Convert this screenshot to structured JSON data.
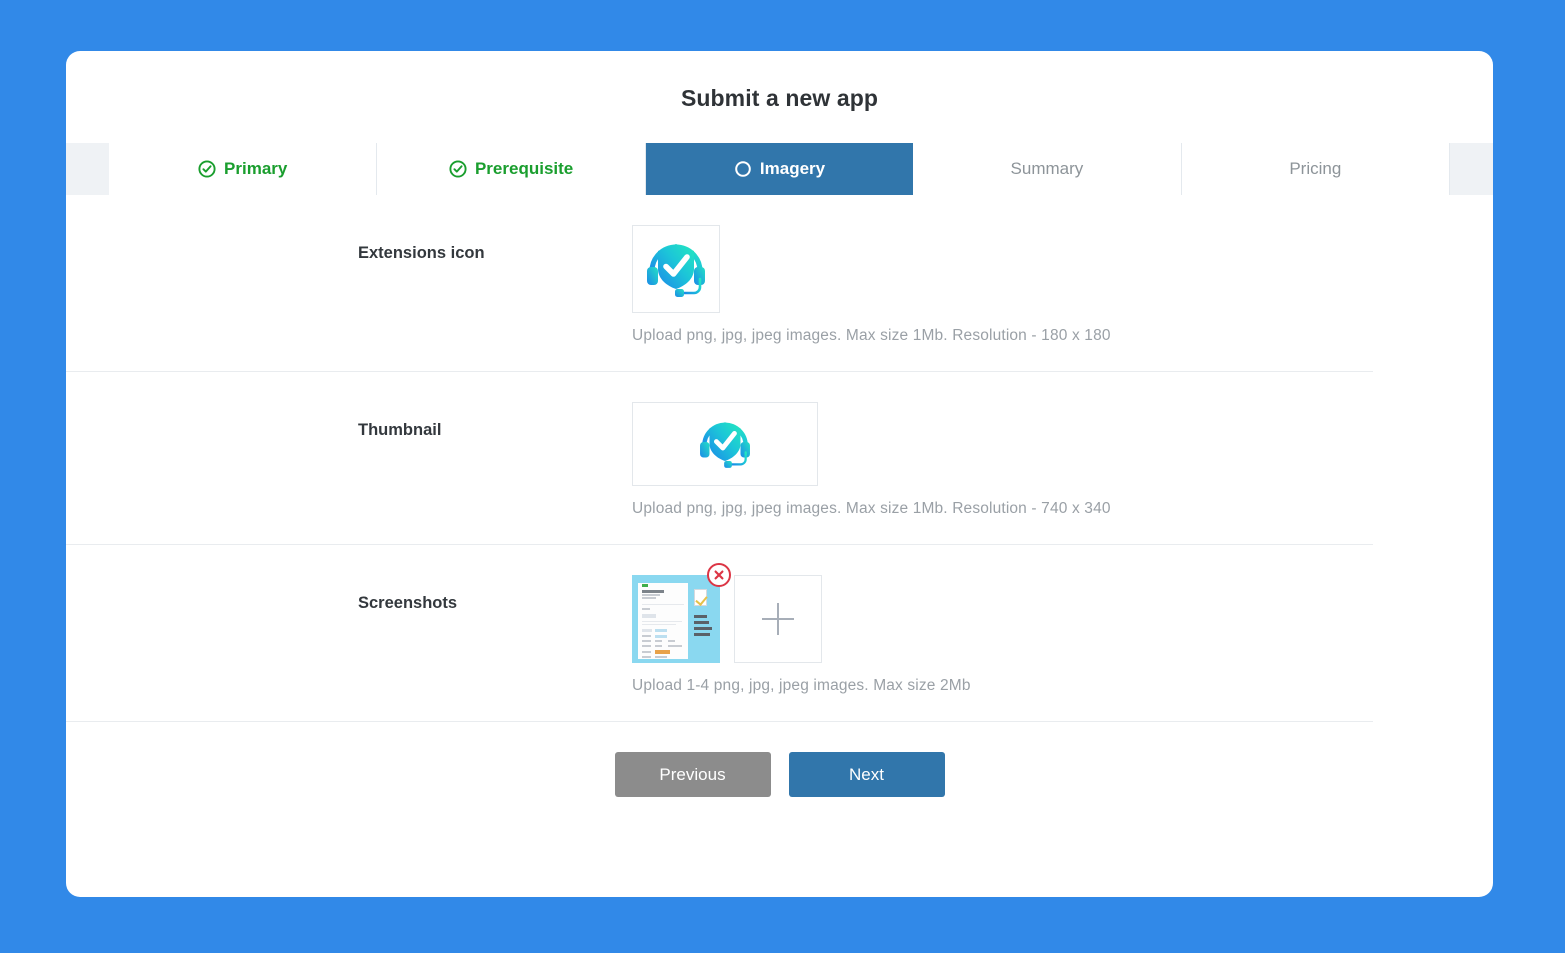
{
  "page": {
    "background_color": "#3189e8",
    "card_background": "#ffffff",
    "title": "Submit a new app"
  },
  "tabs": [
    {
      "label": "Primary",
      "state": "done",
      "icon": "check-circle-icon"
    },
    {
      "label": "Prerequisite",
      "state": "done",
      "icon": "check-circle-icon"
    },
    {
      "label": "Imagery",
      "state": "active",
      "icon": "circle-outline-icon"
    },
    {
      "label": "Summary",
      "state": "inactive",
      "icon": ""
    },
    {
      "label": "Pricing",
      "state": "inactive",
      "icon": ""
    }
  ],
  "colors": {
    "active_tab": "#3176ab",
    "done_tab_text": "#1a9e2e",
    "inactive_tab_text": "#8d9499",
    "tabbar_gutter": "#eff2f5",
    "hint_text": "#9aa0a6",
    "delete_badge": "#dc3545",
    "previous_button": "#8c8c8c",
    "next_button": "#3176ab"
  },
  "rows": [
    {
      "label": "Extensions icon",
      "hint": "Upload png, jpg, jpeg images. Max size 1Mb. Resolution - 180 x 180",
      "preview_icon": "headset-shield-check-icon"
    },
    {
      "label": "Thumbnail",
      "hint": "Upload png, jpg, jpeg images. Max size 1Mb. Resolution - 740 x 340",
      "preview_icon": "headset-shield-check-icon"
    },
    {
      "label": "Screenshots",
      "hint": "Upload 1-4 png, jpg, jpeg images. Max size 2Mb",
      "uploaded_count": 1,
      "add_slot_icon": "plus-icon",
      "delete_icon": "delete-circle-icon"
    }
  ],
  "footer": {
    "previous_label": "Previous",
    "next_label": "Next"
  }
}
